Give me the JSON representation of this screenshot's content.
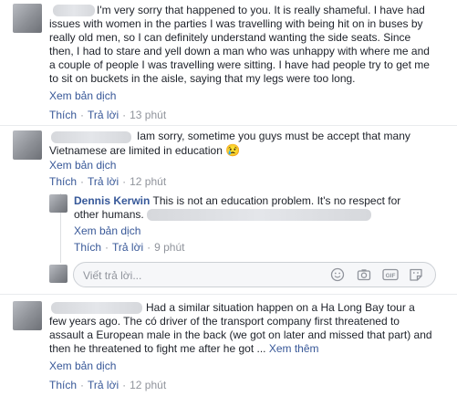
{
  "comments": [
    {
      "text_1": "I'm very sorry that happened to you. It is really shameful. I have had",
      "text_2": "issues with women in the parties I was travelling with being hit on in buses by",
      "text_3": "really old men, so I can definitely understand wanting the side seats. Since",
      "text_4": "then, I had to stare and yell down a man who was unhappy with where me and",
      "text_5": "a couple of people I was travelling were sitting. I have had people try to get me",
      "text_6": "to sit on buckets in the aisle, saying that my legs were too long.",
      "translate": "Xem bản dịch",
      "like": "Thích",
      "reply": "Trả lời",
      "time": "13 phút"
    },
    {
      "text_1": "Iam sorry, sometime you guys must be accept that many",
      "text_2": "Vietnamese are limited in education",
      "emoji": "😢",
      "translate": "Xem bản dịch",
      "like": "Thích",
      "reply": "Trả lời",
      "time": "12 phút"
    },
    {
      "text_1": "Had a similar situation happen on a Ha Long Bay tour a",
      "text_2": "few years ago. The có driver of the transport company first threatened to",
      "text_3": "assault a European male in the back (we got on later and missed that part) and",
      "text_4": "then he threatened to fight me after he got ...",
      "see_more": "Xem thêm",
      "translate": "Xem bản dịch",
      "like": "Thích",
      "reply": "Trả lời",
      "time": "12 phút"
    }
  ],
  "reply_comment": {
    "author": "Dennis Kerwin",
    "text_1": "This is not an education problem. It's no respect for",
    "text_2": "other humans.",
    "translate": "Xem bản dịch",
    "like": "Thích",
    "reply": "Trả lời",
    "time": "9 phút"
  },
  "reply_box": {
    "placeholder": "Viết trả lời..."
  },
  "icons": [
    "emoji-icon",
    "camera-icon",
    "gif-icon",
    "sticker-icon"
  ],
  "colors": {
    "link": "#385898",
    "meta": "#90949c",
    "text": "#1d2129"
  }
}
